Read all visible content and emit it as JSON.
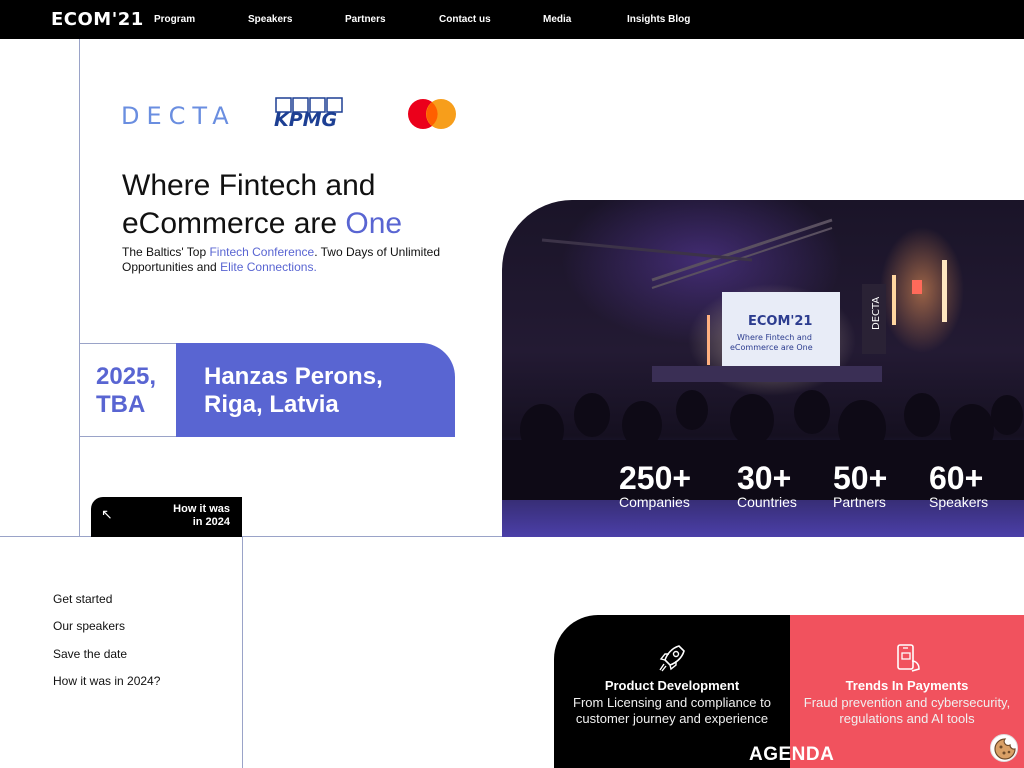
{
  "nav": {
    "logo": "ECOM'21",
    "items": [
      "Program",
      "Speakers",
      "Partners",
      "Contact us",
      "Media",
      "Insights Blog"
    ]
  },
  "partners": {
    "decta": "DECTA",
    "kpmg": "KPMG",
    "mastercard_icon": "mastercard-logo"
  },
  "hero": {
    "headline_1": "Where Fintech and",
    "headline_2": "eCommerce are ",
    "headline_accent": "One",
    "sub_1": "The Baltics' Top ",
    "sub_link_1": "Fintech Conference",
    "sub_2": ". Two Days of Unlimited Opportunities and ",
    "sub_link_2": "Elite Connections.",
    "date_line_1": "2025,",
    "date_line_2": "TBA",
    "venue_line_1": "Hanzas Perons,",
    "venue_line_2": "Riga, Latvia",
    "how_btn_line_1": "How it was",
    "how_btn_line_2": "in 2024",
    "screen_logo": "ECOM'21",
    "screen_line_1": "Where Fintech and",
    "screen_line_2": "eCommerce are One",
    "banner": "DECTA"
  },
  "stats": [
    {
      "value": "250+",
      "label": "Companies"
    },
    {
      "value": "30+",
      "label": "Countries"
    },
    {
      "value": "50+",
      "label": "Partners"
    },
    {
      "value": "60+",
      "label": "Speakers"
    }
  ],
  "sidebar": {
    "items": [
      "Get started",
      "Our speakers",
      "Save the date",
      "How it was in 2024?"
    ]
  },
  "cards": [
    {
      "title": "Product Development",
      "desc": "From Licensing and compliance to customer journey and experience",
      "icon": "rocket-icon"
    },
    {
      "title": "Trends In Payments",
      "desc": "Fraud prevention and cybersecurity, regulations and AI tools",
      "icon": "mobile-payment-icon"
    }
  ],
  "agenda_label": "AGENDA",
  "colors": {
    "accent": "#5965d2",
    "red": "#f1525e",
    "black": "#000000"
  }
}
